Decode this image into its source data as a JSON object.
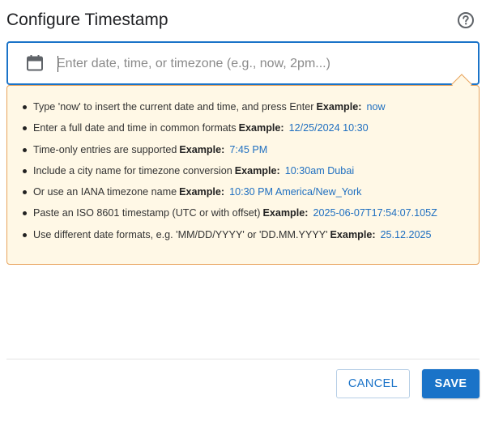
{
  "dialog": {
    "title": "Configure Timestamp"
  },
  "input": {
    "value": "",
    "placeholder": "Enter date, time, or timezone (e.g., now, 2pm...)"
  },
  "hints": [
    {
      "text": "Type 'now' to insert the current date and time, and press Enter",
      "example_label": "Example:",
      "example": "now"
    },
    {
      "text": "Enter a full date and time in common formats",
      "example_label": "Example:",
      "example": "12/25/2024 10:30"
    },
    {
      "text": "Time-only entries are supported",
      "example_label": "Example:",
      "example": "7:45 PM"
    },
    {
      "text": "Include a city name for timezone conversion",
      "example_label": "Example:",
      "example": "10:30am Dubai"
    },
    {
      "text": "Or use an IANA timezone name",
      "example_label": "Example:",
      "example": "10:30 PM America/New_York"
    },
    {
      "text": "Paste an ISO 8601 timestamp (UTC or with offset)",
      "example_label": "Example:",
      "example": "2025-06-07T17:54:07.105Z"
    },
    {
      "text": "Use different date formats, e.g. 'MM/DD/YYYY' or 'DD.MM.YYYY'",
      "example_label": "Example:",
      "example": "25.12.2025"
    }
  ],
  "buttons": {
    "cancel": "CANCEL",
    "save": "SAVE"
  },
  "icons": {
    "help": "help-circle-icon",
    "calendar": "calendar-icon"
  },
  "colors": {
    "accent": "#1a73c8",
    "panel_bg": "#fff8e6",
    "panel_border": "#e8a35c",
    "example_text": "#1f6fc0"
  }
}
